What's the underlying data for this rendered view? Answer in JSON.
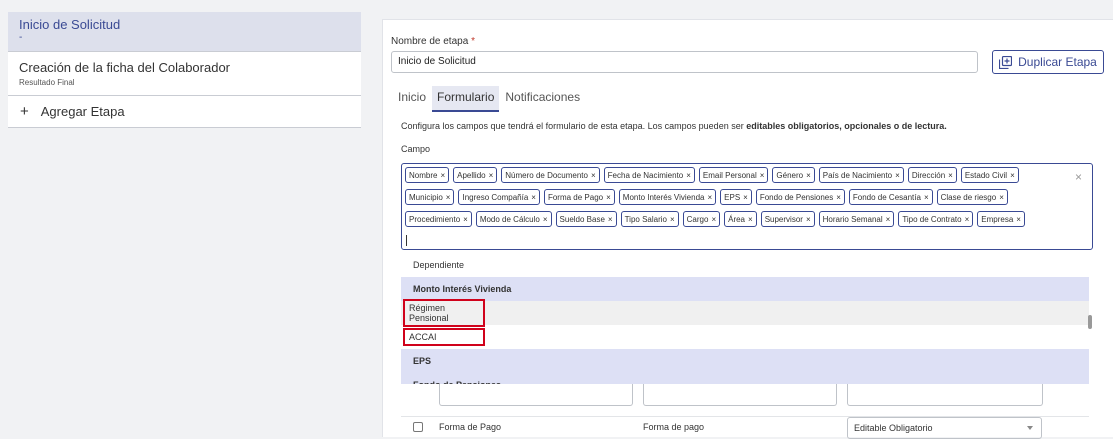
{
  "stages": [
    {
      "title": "Inicio de Solicitud",
      "subtitle": "-",
      "active": true
    },
    {
      "title": "Creación de la ficha del Colaborador",
      "subtitle": "Resultado Final",
      "active": false
    }
  ],
  "add_stage_label": "Agregar Etapa",
  "stage_name": {
    "label": "Nombre de etapa",
    "required_mark": "*",
    "value": "Inicio de Solicitud"
  },
  "duplicate_button": "Duplicar Etapa",
  "tabs": [
    {
      "label": "Inicio",
      "active": false
    },
    {
      "label": "Formulario",
      "active": true
    },
    {
      "label": "Notificaciones",
      "active": false
    }
  ],
  "description": {
    "text": "Configura los campos que tendrá el formulario de esta etapa. Los campos pueden ser ",
    "bold": "editables obligatorios, opcionales o de lectura."
  },
  "campo_label": "Campo",
  "chips": [
    "Nombre",
    "Apellido",
    "Número de Documento",
    "Fecha de Nacimiento",
    "Email Personal",
    "Género",
    "País de Nacimiento",
    "Dirección",
    "Estado Civil",
    "Municipio",
    "Ingreso Compañía",
    "Forma de Pago",
    "Monto Interés Vivienda",
    "EPS",
    "Fondo de Pensiones",
    "Fondo de Cesantía",
    "Clase de riesgo",
    "Procedimiento",
    "Modo de Cálculo",
    "Sueldo Base",
    "Tipo Salario",
    "Cargo",
    "Área",
    "Supervisor",
    "Horario Semanal",
    "Tipo de Contrato",
    "Empresa"
  ],
  "chip_remove": "×",
  "clear_all": "×",
  "dropdown_options": [
    {
      "label": "Dependiente",
      "state": "normal"
    },
    {
      "label": "Monto Interés Vivienda",
      "state": "selected"
    },
    {
      "label": "Régimen Pensional",
      "state": "hover"
    },
    {
      "label": "ACCAI",
      "state": "normal"
    },
    {
      "label": "EPS",
      "state": "selected"
    },
    {
      "label": "Fondo de Pensiones",
      "state": "selected"
    }
  ],
  "table_row": {
    "field": "Forma de Pago",
    "label": "Forma de pago",
    "mode": "Editable Obligatorio"
  },
  "colors": {
    "accent": "#3a4a94",
    "highlight": "#d0021b",
    "selected_bg": "#dde0f5"
  }
}
